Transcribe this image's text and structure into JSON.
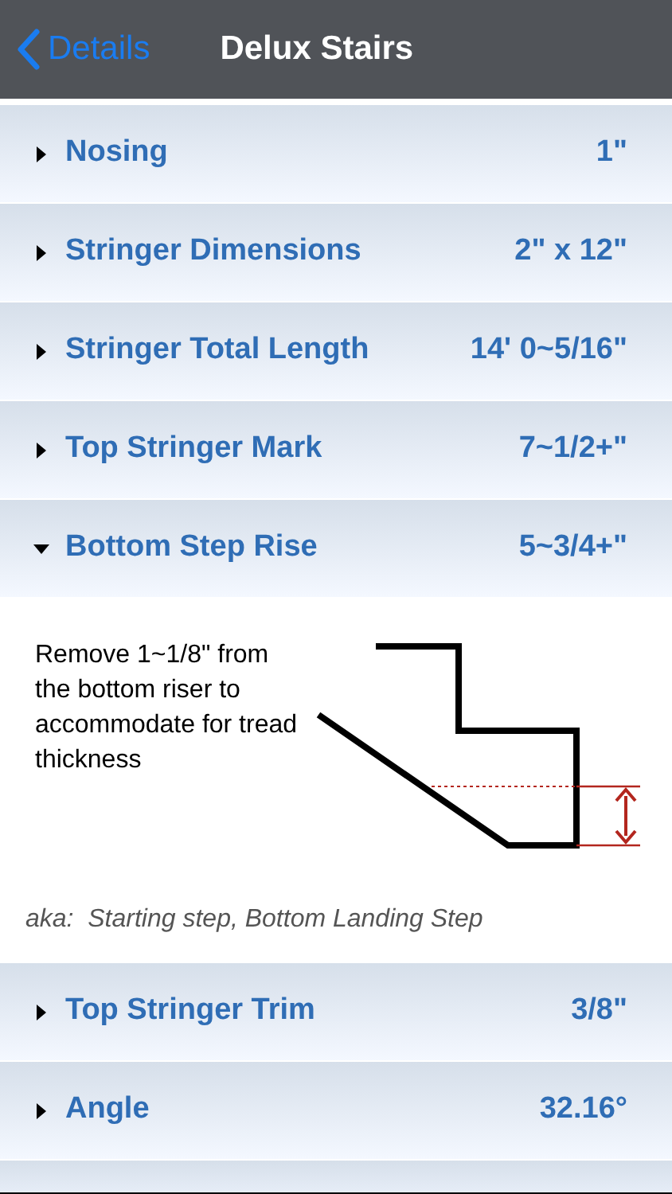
{
  "nav": {
    "back": "Details",
    "title": "Delux Stairs"
  },
  "rows": [
    {
      "label": "Nosing",
      "value": "1\"",
      "expanded": false
    },
    {
      "label": "Stringer Dimensions",
      "value": "2\" x 12\"",
      "expanded": false
    },
    {
      "label": "Stringer Total Length",
      "value": "14' 0~5/16\"",
      "expanded": false
    },
    {
      "label": "Top Stringer Mark",
      "value": "7~1/2+\"",
      "expanded": false
    },
    {
      "label": "Bottom Step Rise",
      "value": "5~3/4+\"",
      "expanded": true,
      "detail": {
        "text": "Remove 1~1/8\" from the bottom riser to accommodate for tread thickness",
        "aka": "aka:  Starting step, Bottom Landing Step"
      }
    },
    {
      "label": "Top Stringer Trim",
      "value": "3/8\"",
      "expanded": false
    },
    {
      "label": "Angle",
      "value": "32.16°",
      "expanded": false
    }
  ]
}
